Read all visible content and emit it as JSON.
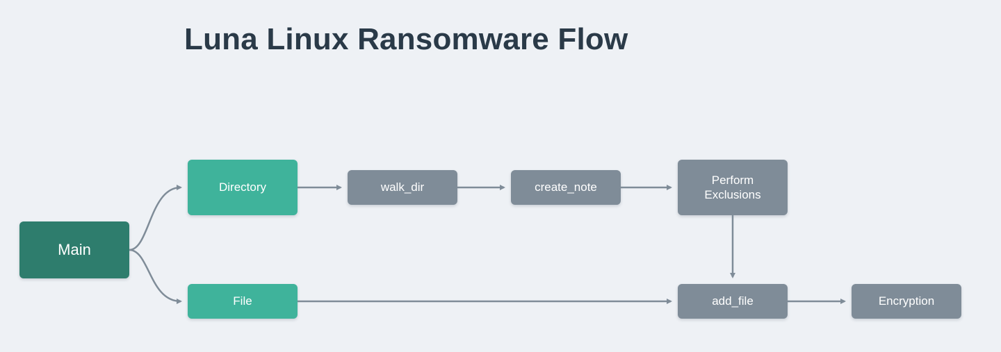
{
  "title": "Luna Linux Ransomware Flow",
  "nodes": {
    "main": {
      "label": "Main"
    },
    "directory": {
      "label": "Directory"
    },
    "file": {
      "label": "File"
    },
    "walk_dir": {
      "label": "walk_dir"
    },
    "create_note": {
      "label": "create_note"
    },
    "perform_exclusions": {
      "label": "Perform Exclusions"
    },
    "add_file": {
      "label": "add_file"
    },
    "encryption": {
      "label": "Encryption"
    }
  },
  "edges": [
    {
      "from": "main",
      "to": "directory"
    },
    {
      "from": "main",
      "to": "file"
    },
    {
      "from": "directory",
      "to": "walk_dir"
    },
    {
      "from": "walk_dir",
      "to": "create_note"
    },
    {
      "from": "create_note",
      "to": "perform_exclusions"
    },
    {
      "from": "perform_exclusions",
      "to": "add_file"
    },
    {
      "from": "file",
      "to": "add_file"
    },
    {
      "from": "add_file",
      "to": "encryption"
    }
  ],
  "colors": {
    "teal_dark": "#2e7d6d",
    "teal": "#3fb39b",
    "slate": "#7f8c98",
    "arrow": "#7f8c98",
    "bg": "#eef1f5",
    "title": "#2a3a48"
  }
}
